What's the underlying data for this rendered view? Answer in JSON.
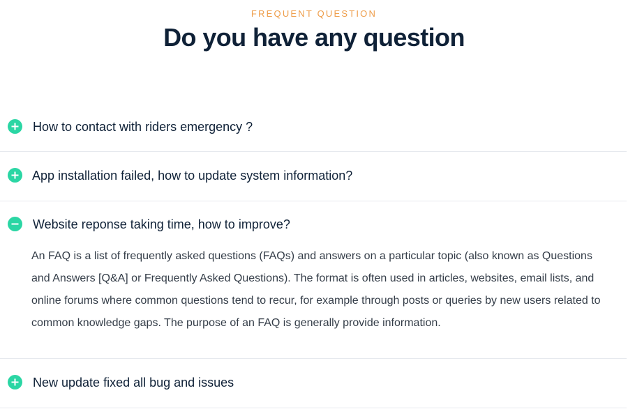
{
  "header": {
    "eyebrow": "FREQUENT QUESTION",
    "title": "Do you have any question"
  },
  "faq": {
    "items": [
      {
        "question": "How to contact with riders emergency ?",
        "state": "collapsed",
        "icon": "plus-circle-icon"
      },
      {
        "question": "App installation failed, how to update system information?",
        "state": "collapsed",
        "icon": "plus-circle-icon"
      },
      {
        "question": "Website reponse taking time, how to improve?",
        "state": "expanded",
        "icon": "minus-circle-icon",
        "answer": "An FAQ is a list of frequently asked questions (FAQs) and answers on a particular topic (also known as Questions and Answers [Q&A] or Frequently Asked Questions). The format is often used in articles, websites, email lists, and online forums where common questions tend to recur, for example through posts or queries by new users related to common knowledge gaps. The purpose of an FAQ is generally provide information."
      },
      {
        "question": "New update fixed all bug and issues",
        "state": "collapsed",
        "icon": "plus-circle-icon"
      }
    ]
  },
  "colors": {
    "accent": "#ee9d4a",
    "icon": "#2bd6a4",
    "heading": "#0f2137",
    "body_text": "#343d48",
    "divider": "#e6e9ee"
  }
}
